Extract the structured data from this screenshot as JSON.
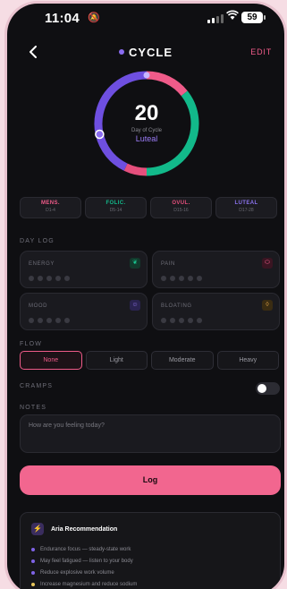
{
  "status_bar": {
    "time": "11:04",
    "battery": "59"
  },
  "nav": {
    "back_icon": "chevron-left-icon",
    "title": "CYCLE",
    "edit_label": "EDIT"
  },
  "cycle": {
    "day": "20",
    "day_label": "Day of Cycle",
    "phase": "Luteal",
    "total_days": 28,
    "current_day": 20
  },
  "colors": {
    "menstrual": "#ef5b89",
    "follicular": "#12b98a",
    "ovulation": "#e54f7c",
    "luteal": "#6e4fe0",
    "accent": "#f2668f"
  },
  "phases": [
    {
      "name": "MENS.",
      "range": "D1-4",
      "color": "#ef5b89"
    },
    {
      "name": "FOLIC.",
      "range": "D5-14",
      "color": "#12b98a"
    },
    {
      "name": "OVUL.",
      "range": "D15-16",
      "color": "#e54f7c"
    },
    {
      "name": "LUTEAL",
      "range": "D17-28",
      "color": "#8c74f0"
    }
  ],
  "day_log": {
    "label": "DAY LOG",
    "cards": [
      {
        "name": "ENERGY",
        "icon": "leaf-icon",
        "value": 0,
        "max": 5
      },
      {
        "name": "PAIN",
        "icon": "pill-icon",
        "value": 0,
        "max": 5
      },
      {
        "name": "MOOD",
        "icon": "smile-icon",
        "value": 0,
        "max": 5
      },
      {
        "name": "BLOATING",
        "icon": "drop-icon",
        "value": 0,
        "max": 5
      }
    ]
  },
  "flow": {
    "label": "FLOW",
    "options": [
      "None",
      "Light",
      "Moderate",
      "Heavy"
    ],
    "selected": "None"
  },
  "cramps": {
    "label": "CRAMPS",
    "on": false
  },
  "notes": {
    "label": "NOTES",
    "placeholder": "How are you feeling today?"
  },
  "log_button": "Log",
  "recommendation": {
    "title": "Aria Recommendation",
    "icon": "bolt-icon",
    "items": [
      "Endurance focus — steady-state work",
      "May feel fatigued — listen to your body",
      "Reduce explosive work volume",
      "Increase magnesium and reduce sodium"
    ]
  }
}
